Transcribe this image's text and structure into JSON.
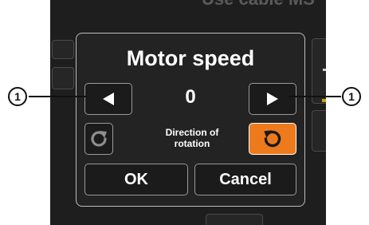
{
  "background": {
    "partial_header_text": "Use cable MS"
  },
  "dialog": {
    "title": "Motor speed",
    "speed_value": "0",
    "decrease_icon": "left-triangle-icon",
    "increase_icon": "right-triangle-icon",
    "direction_label": "Direction of rotation",
    "rotate_cw_icon": "rotate-clockwise-icon",
    "rotate_ccw_icon": "rotate-counterclockwise-icon",
    "ok_label": "OK",
    "cancel_label": "Cancel",
    "selected_direction": "counterclockwise"
  },
  "callouts": [
    {
      "label": "1"
    },
    {
      "label": "1"
    }
  ],
  "colors": {
    "screen_bg": "#1e1e1e",
    "dialog_bg": "#232323",
    "active_accent": "#ee7a1e",
    "text": "#ffffff"
  }
}
